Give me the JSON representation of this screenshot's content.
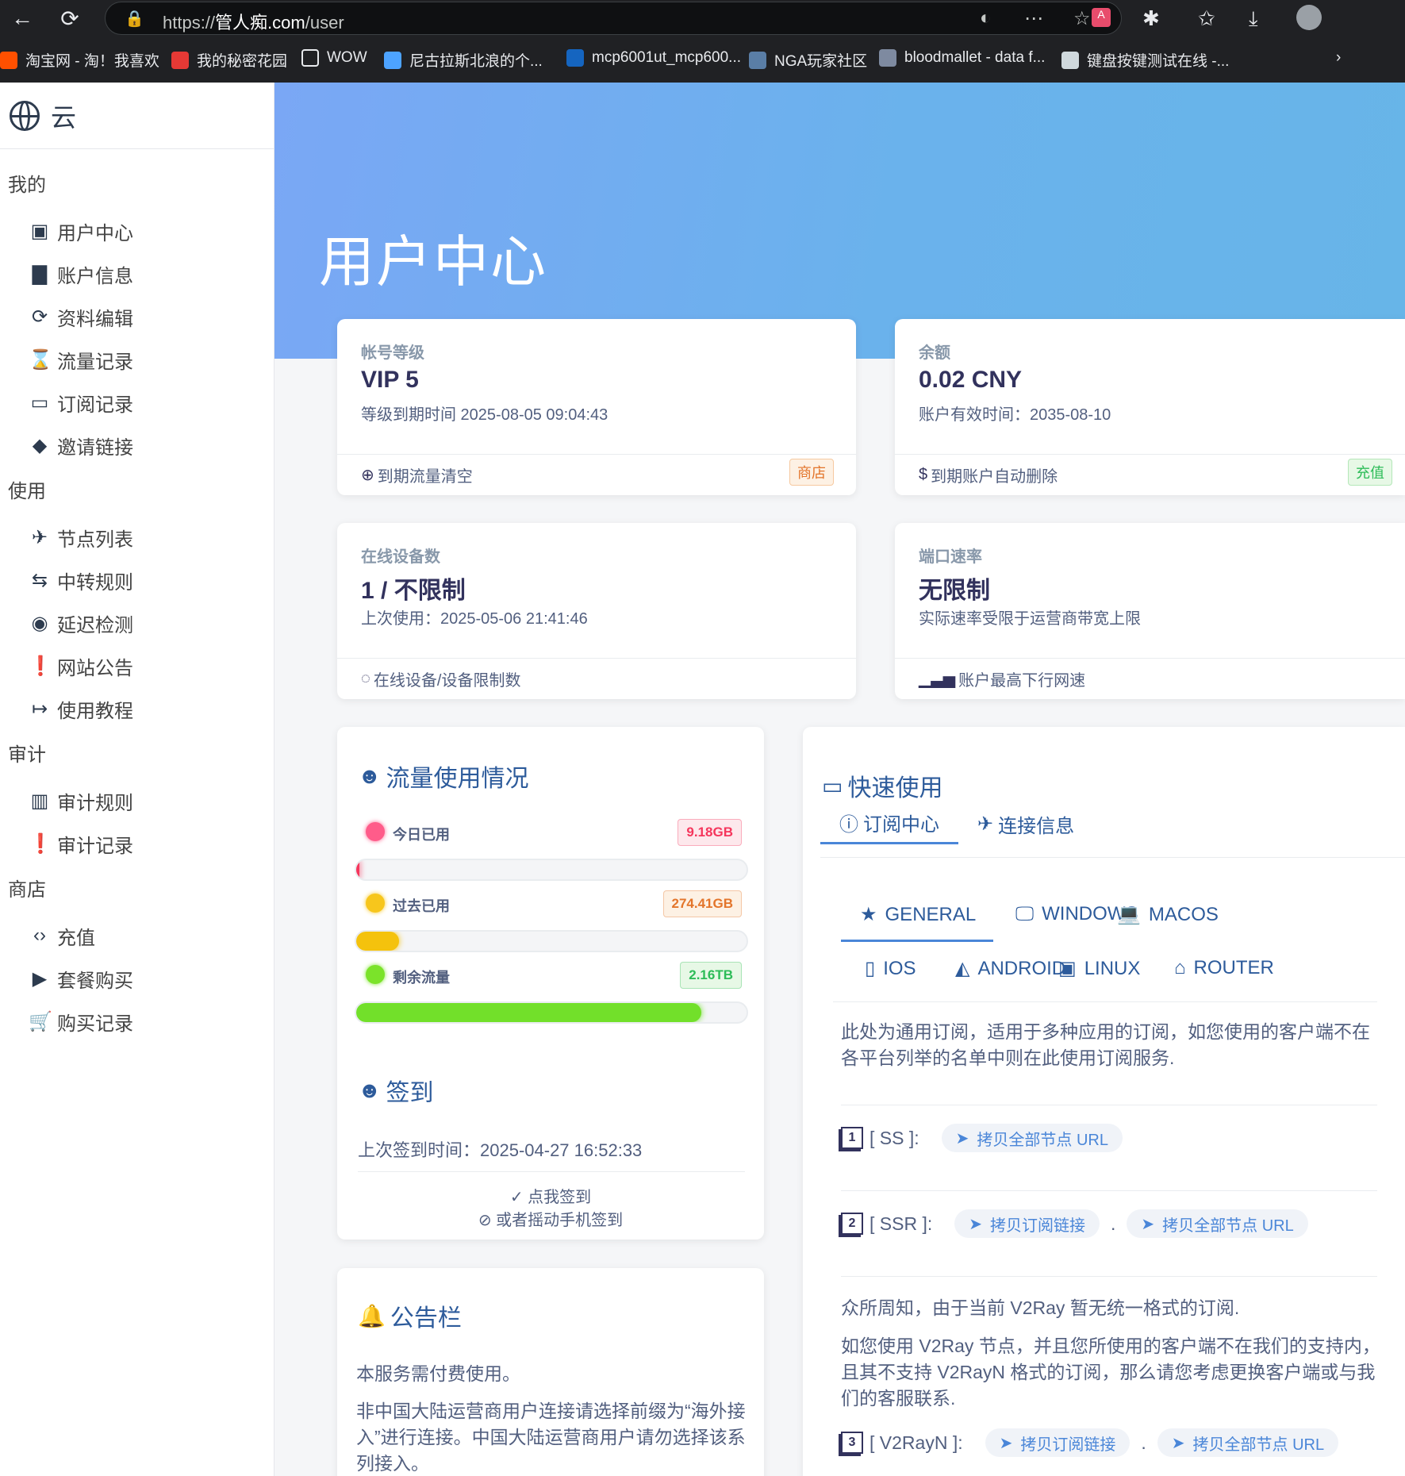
{
  "browser": {
    "url_prefix": "https://",
    "url_host": "管人痴.com",
    "url_path": "/user",
    "bookmarks": [
      {
        "icon": "淘",
        "label": "淘宝网 - 淘！我喜欢",
        "color": "#ff5000"
      },
      {
        "icon": "DX",
        "label": "我的秘密花园",
        "color": "#e53935"
      },
      {
        "icon": "",
        "label": "WOW",
        "color": ""
      },
      {
        "icon": "tv",
        "label": "尼古拉斯北浪的个...",
        "color": "#4da3ff"
      },
      {
        "icon": "LC",
        "label": "mcp6001ut_mcp600...",
        "color": "#1565c0"
      },
      {
        "icon": "N",
        "label": "NGA玩家社区",
        "color": "#5a7ea6"
      },
      {
        "icon": "b",
        "label": "bloodmallet - data f...",
        "color": "#7e8aa0"
      },
      {
        "icon": "k",
        "label": "键盘按键测试在线 -...",
        "color": "#cfd8dc"
      }
    ]
  },
  "sidebar": {
    "brand": "云",
    "sections": [
      {
        "title": "我的",
        "items": [
          {
            "icon": "wallet-icon",
            "glyph": "▣",
            "label": "用户中心"
          },
          {
            "icon": "account-icon",
            "glyph": "▇",
            "label": "账户信息"
          },
          {
            "icon": "sync-icon",
            "glyph": "⟳",
            "label": "资料编辑"
          },
          {
            "icon": "hourglass-icon",
            "glyph": "⌛",
            "label": "流量记录"
          },
          {
            "icon": "monitor-icon",
            "glyph": "▭",
            "label": "订阅记录"
          },
          {
            "icon": "tag-icon",
            "glyph": "◆",
            "label": "邀请链接"
          }
        ]
      },
      {
        "title": "使用",
        "items": [
          {
            "icon": "airplane-icon",
            "glyph": "✈",
            "label": "节点列表"
          },
          {
            "icon": "transfer-icon",
            "glyph": "⇆",
            "label": "中转规则"
          },
          {
            "icon": "eye-icon",
            "glyph": "◉",
            "label": "延迟检测"
          },
          {
            "icon": "announcement-icon",
            "glyph": "❗",
            "label": "网站公告"
          },
          {
            "icon": "arrow-right-icon",
            "glyph": "↦",
            "label": "使用教程"
          }
        ]
      },
      {
        "title": "审计",
        "items": [
          {
            "icon": "bank-icon",
            "glyph": "▥",
            "label": "审计规则"
          },
          {
            "icon": "report-icon",
            "glyph": "❗",
            "label": "审计记录"
          }
        ]
      },
      {
        "title": "商店",
        "items": [
          {
            "icon": "code-icon",
            "glyph": "‹›",
            "label": "充值"
          },
          {
            "icon": "shopping-bag-icon",
            "glyph": "▶",
            "label": "套餐购买"
          },
          {
            "icon": "cart-icon",
            "glyph": "🛒",
            "label": "购买记录"
          }
        ]
      }
    ]
  },
  "hero": {
    "title": "用户中心"
  },
  "stats": {
    "level": {
      "label": "帐号等级",
      "value": "VIP 5",
      "sub": "等级到期时间 2025-08-05 09:04:43",
      "foot": "到期流量清空",
      "badge": "商店"
    },
    "balance": {
      "label": "余额",
      "value": "0.02 CNY",
      "sub": "账户有效时间：2035-08-10",
      "foot": "到期账户自动删除",
      "badge": "充值"
    },
    "devices": {
      "label": "在线设备数",
      "value": "1 / 不限制",
      "sub": "上次使用：2025-05-06 21:41:46",
      "foot": "在线设备/设备限制数"
    },
    "speed": {
      "label": "端口速率",
      "value": "无限制",
      "sub": "实际速率受限于运营商带宽上限",
      "foot": "账户最高下行网速"
    }
  },
  "traffic": {
    "title": "流量使用情况",
    "rows": [
      {
        "label": "今日已用",
        "value": "9.18GB",
        "fraction": 0.004,
        "dot": "#ff5c8a",
        "fill": "#f5365c",
        "badge_bg": "#fde8ec",
        "badge_color": "#f5365c"
      },
      {
        "label": "过去已用",
        "value": "274.41GB",
        "fraction": 0.11,
        "dot": "#f7c61c",
        "fill": "#f4c20d",
        "badge_bg": "#fdf1e4",
        "badge_color": "#e3752b"
      },
      {
        "label": "剩余流量",
        "value": "2.16TB",
        "fraction": 0.885,
        "dot": "#7be32a",
        "fill": "#72e02a",
        "badge_bg": "#e7f8e6",
        "badge_color": "#2dbc58"
      }
    ]
  },
  "checkin": {
    "title": "签到",
    "last": "上次签到时间：2025-04-27 16:52:33",
    "action": "点我签到",
    "alt": "或者摇动手机签到"
  },
  "notice": {
    "title": "公告栏",
    "p1": "本服务需付费使用。",
    "p2": "非中国大陆运营商用户连接请选择前缀为“海外接入”进行连接。中国大陆运营商用户请勿选择该系列接入。"
  },
  "quick": {
    "title": "快速使用",
    "tabs": [
      "订阅中心",
      "连接信息"
    ],
    "platforms_row1": [
      "GENERAL",
      "WINDOWS",
      "MACOS"
    ],
    "platforms_row2": [
      "IOS",
      "ANDROID",
      "LINUX",
      "ROUTER"
    ],
    "desc": "此处为通用订阅，适用于多种应用的订阅，如您使用的客户端不在各平台列举的名单中则在此使用订阅服务.",
    "ss": {
      "label": "[ SS ]:",
      "btn": "拷贝全部节点 URL"
    },
    "ssr": {
      "label": "[ SSR ]:",
      "btn1": "拷贝订阅链接",
      "sep": ".",
      "btn2": "拷贝全部节点 URL"
    },
    "v2_p1": "众所周知，由于当前 V2Ray 暂无统一格式的订阅.",
    "v2_p2": "如您使用 V2Ray 节点，并且您所使用的客户端不在我们的支持内，且其不支持 V2RayN 格式的订阅，那么请您考虑更换客户端或与我们的客服联系.",
    "v2rayn": {
      "label": "[ V2RayN ]:",
      "btn1": "拷贝订阅链接",
      "sep": ".",
      "btn2": "拷贝全部节点 URL"
    }
  }
}
